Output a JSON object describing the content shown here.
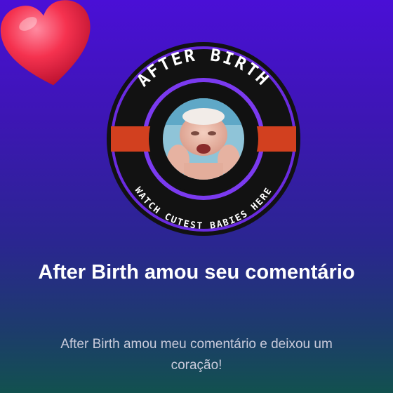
{
  "badge": {
    "top_text": "AFTER BIRTH",
    "bottom_text": "WATCH CUTEST BABIES HERE",
    "avatar_icon": "baby-photo",
    "colors": {
      "ring_outer": "#6a2be0",
      "ring_inner": "#7b3af0",
      "band": "#d2401f",
      "core": "#111111"
    }
  },
  "reaction_icon": "heart-icon",
  "notification": {
    "headline": "After Birth amou seu comentário",
    "message": "After Birth amou meu comentário e deixou um coração!"
  }
}
